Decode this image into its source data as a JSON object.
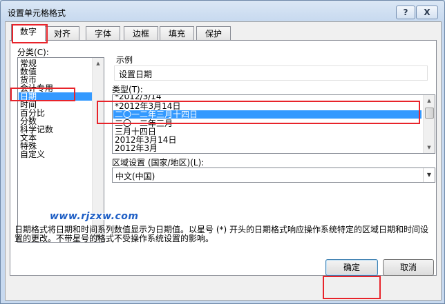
{
  "window": {
    "title": "设置单元格格式",
    "help_label": "?",
    "close_label": "X"
  },
  "tabs": [
    {
      "label": "数字"
    },
    {
      "label": "对齐"
    },
    {
      "label": "字体"
    },
    {
      "label": "边框"
    },
    {
      "label": "填充"
    },
    {
      "label": "保护"
    }
  ],
  "category": {
    "label": "分类",
    "shortcut": "(C):",
    "items": [
      "常规",
      "数值",
      "货币",
      "会计专用",
      "日期",
      "时间",
      "百分比",
      "分数",
      "科学记数",
      "文本",
      "特殊",
      "自定义"
    ],
    "selected": "日期"
  },
  "sample": {
    "label": "示例",
    "value": "设置日期"
  },
  "type": {
    "label": "类型",
    "shortcut": "(T):",
    "items": [
      "*2012/3/14",
      "*2012年3月14日",
      "二〇一二年三月十四日",
      "二〇一二年三月",
      "三月十四日",
      "2012年3月14日",
      "2012年3月"
    ],
    "selected": "二〇一二年三月十四日"
  },
  "locale": {
    "label": "区域设置 (国家/地区)",
    "shortcut": "(L):",
    "value": "中文(中国)"
  },
  "description": "日期格式将日期和时间系列数值显示为日期值。以星号 (*) 开头的日期格式响应操作系统特定的区域日期和时间设置的更改。不带星号的格式不受操作系统设置的影响。",
  "buttons": {
    "ok": "确定",
    "cancel": "取消"
  },
  "watermark": "www.rjzxw.com",
  "colors": {
    "selection": "#3399ff",
    "highlight_box": "#e8232a"
  }
}
